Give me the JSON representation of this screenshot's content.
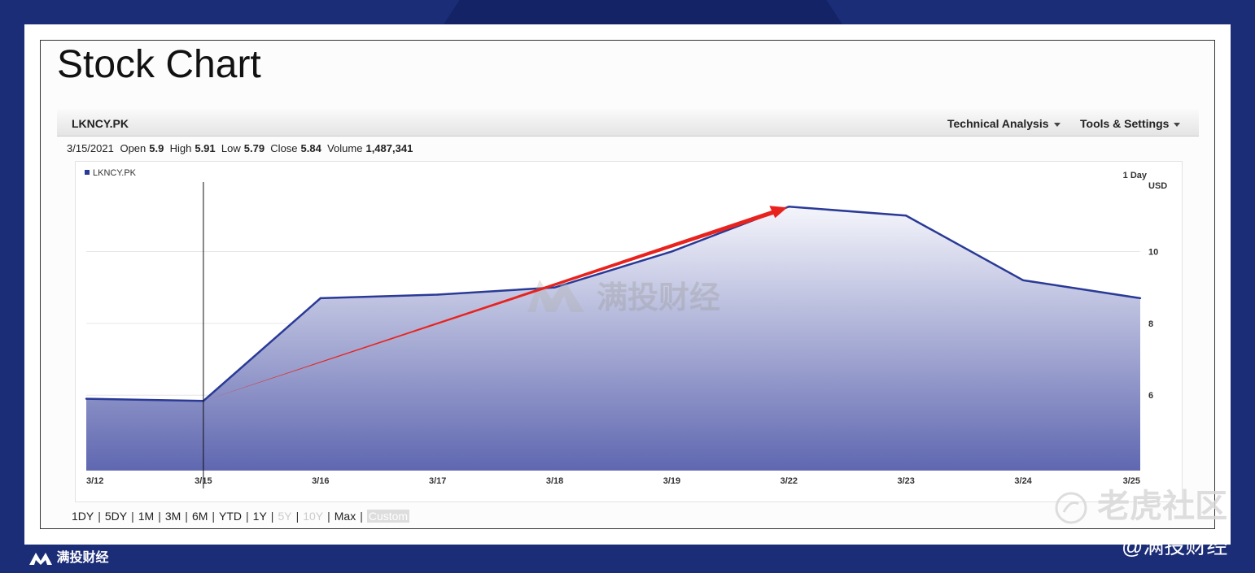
{
  "page": {
    "title": "Stock Chart"
  },
  "toolbar": {
    "ticker": "LKNCY.PK",
    "technical_analysis": "Technical Analysis",
    "tools_settings": "Tools & Settings"
  },
  "quote": {
    "date": "3/15/2021",
    "open_label": "Open",
    "open": "5.9",
    "high_label": "High",
    "high": "5.91",
    "low_label": "Low",
    "low": "5.79",
    "close_label": "Close",
    "close": "5.84",
    "volume_label": "Volume",
    "volume": "1,487,341"
  },
  "ranges": {
    "items": [
      "1DY",
      "5DY",
      "1M",
      "3M",
      "6M",
      "YTD",
      "1Y",
      "5Y",
      "10Y",
      "Max",
      "Custom"
    ],
    "disabled": [
      "5Y",
      "10Y"
    ],
    "selected": "Custom"
  },
  "chart_data": {
    "type": "area",
    "legend": "LKNCY.PK",
    "interval_label": "1 Day",
    "currency_label": "USD",
    "categories": [
      "3/12",
      "3/15",
      "3/16",
      "3/17",
      "3/18",
      "3/19",
      "3/22",
      "3/23",
      "3/24",
      "3/25"
    ],
    "series": [
      {
        "name": "LKNCY.PK",
        "values": [
          5.9,
          5.84,
          8.7,
          8.8,
          9.0,
          10.0,
          11.25,
          11.0,
          9.2,
          8.7
        ]
      }
    ],
    "yticks": [
      6,
      8,
      10
    ],
    "ylim": [
      3.9,
      12.5
    ],
    "crosshair_category": "3/15",
    "annotation": {
      "type": "arrow",
      "from": {
        "x": "3/15",
        "y": 5.84
      },
      "to": {
        "x": "3/22",
        "y": 11.25
      },
      "color": "#e8231e"
    },
    "colors": {
      "line": "#2a3a96",
      "area_top": "#f4f5fb",
      "area_bottom": "#5f67b0"
    }
  },
  "watermarks": {
    "center": "满投财经",
    "bottom_left": "满投财经",
    "right_top": "老虎社区",
    "right_bottom": "@满投财经"
  }
}
